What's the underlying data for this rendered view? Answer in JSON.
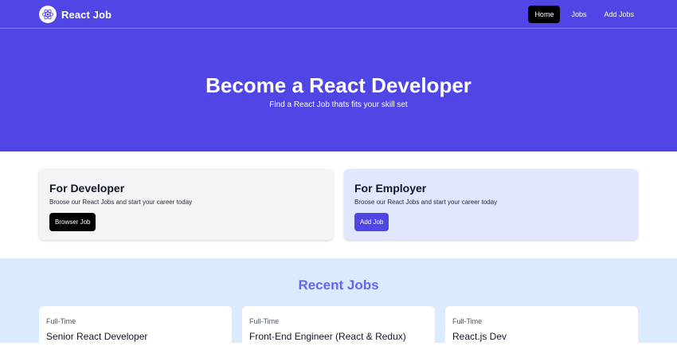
{
  "navbar": {
    "brand": "React Job",
    "logo_icon": "react-atom-icon",
    "links": [
      {
        "label": "Home",
        "active": true
      },
      {
        "label": "Jobs",
        "active": false
      },
      {
        "label": "Add Jobs",
        "active": false
      }
    ]
  },
  "hero": {
    "title": "Become a React Developer",
    "subtitle": "Find a React Job thats fits your skill set"
  },
  "cards": {
    "developer": {
      "title": "For Developer",
      "text": "Broose our React Jobs and start your career today",
      "button": "Browser Job"
    },
    "employer": {
      "title": "For Employer",
      "text": "Broose our React Jobs and start your career today",
      "button": "Add Job"
    }
  },
  "recent_jobs": {
    "title": "Recent Jobs",
    "jobs": [
      {
        "type": "Full-Time",
        "title": "Senior React Developer"
      },
      {
        "type": "Full-Time",
        "title": "Front-End Engineer (React & Redux)"
      },
      {
        "type": "Full-Time",
        "title": "React.js Dev"
      }
    ]
  },
  "colors": {
    "primary": "#4f46e5",
    "accent_text": "#6366f1",
    "jobs_bg": "#dbeafe",
    "employer_card_bg": "#e0e7ff",
    "developer_card_bg": "#f3f4f6"
  }
}
